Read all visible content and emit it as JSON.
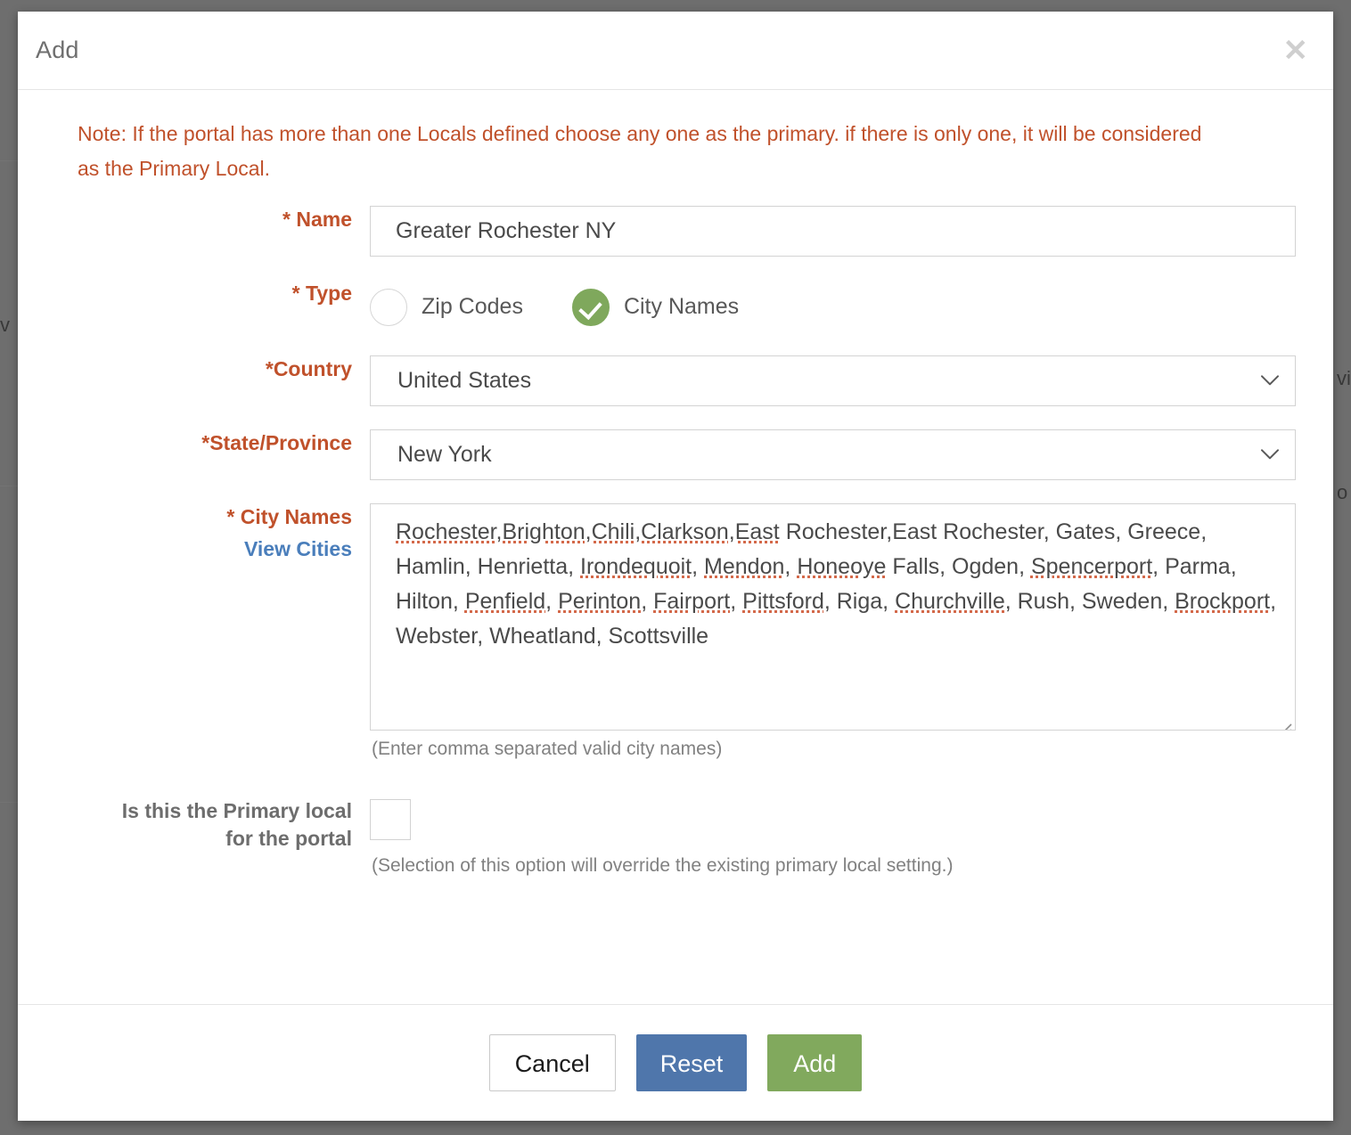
{
  "modal": {
    "title": "Add",
    "close_icon": "close-icon",
    "note": "Note: If the portal has more than one Locals defined choose any one as the primary. if there is only one, it will be considered as the Primary Local.",
    "fields": {
      "name": {
        "label": "* Name",
        "value": "Greater Rochester NY"
      },
      "type": {
        "label": "* Type",
        "options": [
          {
            "label": "Zip Codes",
            "selected": false
          },
          {
            "label": "City Names",
            "selected": true
          }
        ]
      },
      "country": {
        "label": "*Country",
        "value": "United States",
        "chevron_icon": "chevron-down-icon"
      },
      "state": {
        "label": "*State/Province",
        "value": "New York",
        "chevron_icon": "chevron-down-icon"
      },
      "city_names": {
        "label": "* City Names",
        "sub_link": "View Cities",
        "value": "Rochester,Brighton,Chili,Clarkson,East Rochester,East Rochester, Gates, Greece, Hamlin, Henrietta, Irondequoit, Mendon, Honeoye Falls, Ogden, Spencerport, Parma, Hilton, Penfield, Perinton, Fairport, Pittsford, Riga, Churchville, Rush, Sweden, Brockport, Webster, Wheatland, Scottsville",
        "hint": "(Enter comma separated valid city names)",
        "resize_icon": "resize-grip-icon"
      },
      "primary_local": {
        "label_line1": "Is this the Primary local",
        "label_line2": "for the portal",
        "checked": false,
        "hint": "(Selection of this option will override the existing primary local setting.)"
      }
    },
    "footer": {
      "cancel_label": "Cancel",
      "reset_label": "Reset",
      "add_label": "Add"
    }
  },
  "colors": {
    "required_label": "#c0512b",
    "link": "#4a7ebb",
    "accent_green": "#81a95d",
    "accent_blue": "#4f76ab",
    "overlay": "#6e6e6e"
  }
}
